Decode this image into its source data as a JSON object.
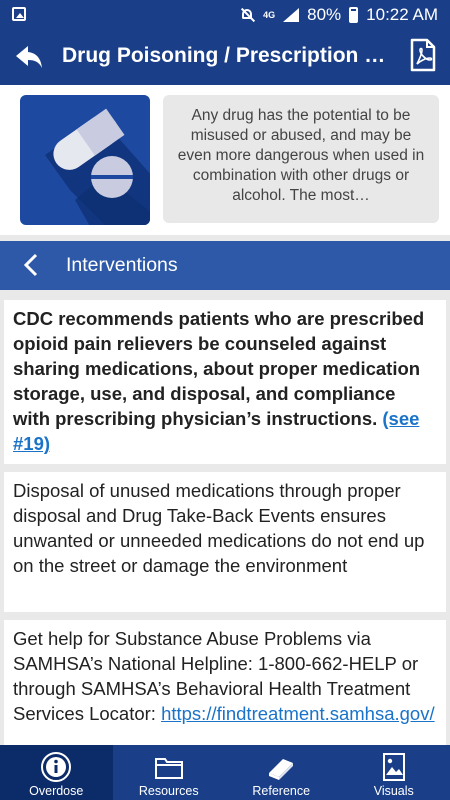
{
  "status_bar": {
    "icons": [
      "image-icon",
      "mute-icon",
      "signal-icon",
      "battery-icon"
    ],
    "network": "4G",
    "battery_percent": "80%",
    "time": "10:22 AM"
  },
  "header": {
    "title": "Drug Poisoning / Prescription Drug Abuse",
    "back_icon": "back-arrow-icon",
    "pdf_icon": "pdf-icon"
  },
  "intro": {
    "icon": "pills-icon",
    "text": "Any drug has the potential to be misused or abused, and may be even more dangerous when used in combination with other drugs or alcohol. The most…"
  },
  "section": {
    "title": "Interventions",
    "back_icon": "chevron-left-icon"
  },
  "cards": [
    {
      "text": "CDC recommends patients who are prescribed opioid pain relievers be counseled against sharing medications, about proper medication storage, use, and disposal, and compliance with prescribing physician’s instructions.",
      "link": "(see #19)"
    },
    {
      "text": "Disposal of unused medications through proper disposal and Drug Take-Back Events ensures unwanted or unneeded medications do not end up on the street or damage the environment"
    },
    {
      "text": "Get help for Substance Abuse Problems via SAMHSA’s National Helpline: 1-800-662-HELP or through SAMHSA’s Behavioral Health Treatment Services Locator:",
      "link": "https://findtreatment.samhsa.gov/"
    }
  ],
  "tabs": [
    {
      "label": "Overdose",
      "icon": "info-icon",
      "active": true
    },
    {
      "label": "Resources",
      "icon": "folder-icon",
      "active": false
    },
    {
      "label": "Reference",
      "icon": "book-icon",
      "active": false
    },
    {
      "label": "Visuals",
      "icon": "image-icon",
      "active": false
    }
  ],
  "colors": {
    "header": "#1a3f88",
    "section_bar": "#2d59a8",
    "active_tab": "#0c2b69",
    "link": "#1a73c8"
  }
}
